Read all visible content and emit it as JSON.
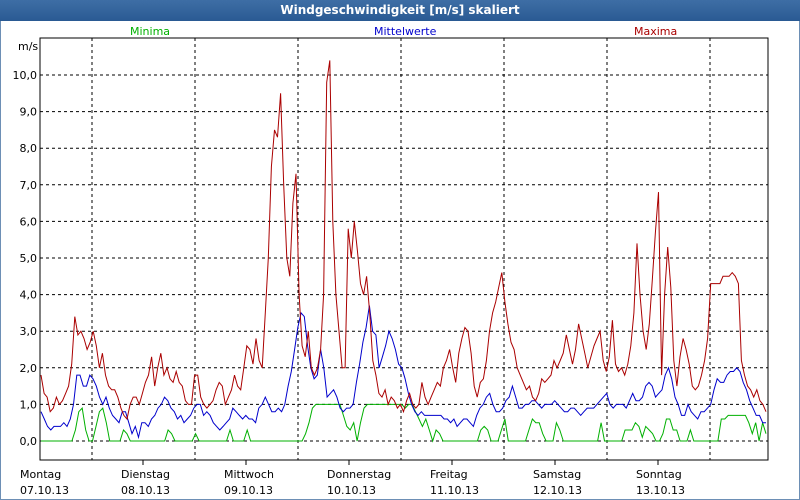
{
  "window": {
    "title": "Windgeschwindigkeit [m/s] skaliert"
  },
  "colors": {
    "minima": "#00b000",
    "mittelwerte": "#0000cc",
    "maxima": "#aa0000",
    "title_bg": "#2f5f98",
    "grid": "#000000"
  },
  "chart_data": {
    "type": "line",
    "title": "Windgeschwindigkeit [m/s] skaliert",
    "ylabel": "m/s",
    "ylim": [
      -0.2,
      10.8
    ],
    "yticks": [
      "0,0",
      "1,0",
      "2,0",
      "3,0",
      "4,0",
      "5,0",
      "6,0",
      "7,0",
      "8,0",
      "9,0",
      "10,0"
    ],
    "days": [
      {
        "name": "Montag",
        "date": "07.10.13"
      },
      {
        "name": "Dienstag",
        "date": "08.10.13"
      },
      {
        "name": "Mittwoch",
        "date": "09.10.13"
      },
      {
        "name": "Donnerstag",
        "date": "10.10.13"
      },
      {
        "name": "Freitag",
        "date": "11.10.13"
      },
      {
        "name": "Samstag",
        "date": "12.10.13"
      },
      {
        "name": "Sonntag",
        "date": "13.10.13"
      }
    ],
    "legend_position": "top",
    "grid": true,
    "series": [
      {
        "name": "Minima",
        "values": [
          0,
          0,
          0,
          0,
          0,
          0,
          0,
          0,
          0,
          0,
          0.3,
          0.8,
          0.9,
          0.3,
          0,
          0,
          0.4,
          0.8,
          0.9,
          0.5,
          0,
          0,
          0,
          0,
          0.3,
          0.2,
          0,
          0,
          0,
          0,
          0,
          0,
          0,
          0,
          0,
          0,
          0,
          0.3,
          0.2,
          0,
          0,
          0,
          0,
          0,
          0,
          0.2,
          0,
          0,
          0,
          0,
          0,
          0,
          0,
          0,
          0,
          0.3,
          0,
          0,
          0,
          0,
          0.3,
          0,
          0,
          0,
          0,
          0,
          0,
          0,
          0,
          0,
          0,
          0,
          0,
          0,
          0,
          0,
          0,
          0.2,
          0.5,
          0.9,
          1.0,
          1.0,
          1.0,
          1.0,
          1.0,
          1.0,
          1.0,
          1.0,
          0.7,
          0.4,
          0.3,
          0.5,
          0,
          0.5,
          0.9,
          1.0,
          1.0,
          1.0,
          1.0,
          1.0,
          1.0,
          1.0,
          1.0,
          1.0,
          1.0,
          1.0,
          0.9,
          1.0,
          1.0,
          0.8,
          0.6,
          0.4,
          0.6,
          0.3,
          0,
          0.3,
          0.2,
          0,
          0,
          0,
          0,
          0,
          0,
          0,
          0,
          0,
          0,
          0,
          0.3,
          0.4,
          0.3,
          0,
          0,
          0,
          0.3,
          0.6,
          0,
          0,
          0,
          0,
          0,
          0,
          0.3,
          0.6,
          0.5,
          0.5,
          0.2,
          0,
          0,
          0,
          0.5,
          0.3,
          0,
          0,
          0,
          0,
          0,
          0,
          0,
          0,
          0,
          0,
          0,
          0.5,
          0,
          0,
          0,
          0,
          0,
          0,
          0.3,
          0.3,
          0.3,
          0.5,
          0.4,
          0.1,
          0.4,
          0.3,
          0.2,
          0,
          0,
          0.2,
          0.6,
          0.6,
          0.3,
          0.3,
          0,
          0,
          0,
          0.3,
          0,
          0,
          0,
          0,
          0,
          0,
          0,
          0,
          0.6,
          0.6,
          0.7,
          0.7,
          0.7,
          0.7,
          0.7,
          0.7,
          0.5,
          0.2,
          0.5,
          0,
          0.5,
          0.2
        ]
      },
      {
        "name": "Mittelwerte",
        "values": [
          0.8,
          0.6,
          0.4,
          0.3,
          0.4,
          0.4,
          0.4,
          0.5,
          0.4,
          0.6,
          1.0,
          1.8,
          1.8,
          1.5,
          1.5,
          1.8,
          1.7,
          1.5,
          1.2,
          1.0,
          1.2,
          0.9,
          0.7,
          0.6,
          0.5,
          0.8,
          0.8,
          0.5,
          0.2,
          0.4,
          0.1,
          0.5,
          0.5,
          0.4,
          0.6,
          0.7,
          0.9,
          1.0,
          1.2,
          1.1,
          0.9,
          0.8,
          0.6,
          0.7,
          0.5,
          0.6,
          0.7,
          0.9,
          1.0,
          1.0,
          0.7,
          0.8,
          0.7,
          0.5,
          0.4,
          0.3,
          0.4,
          0.5,
          0.6,
          0.9,
          0.8,
          0.7,
          0.6,
          0.7,
          0.6,
          0.6,
          0.5,
          0.9,
          1.0,
          1.2,
          1.0,
          0.8,
          0.8,
          0.9,
          0.8,
          1.0,
          1.5,
          1.9,
          2.5,
          3.1,
          3.5,
          3.4,
          2.6,
          2.0,
          1.7,
          1.8,
          2.5,
          2.0,
          1.2,
          1.3,
          1.4,
          1.2,
          0.9,
          0.8,
          0.9,
          0.9,
          1.0,
          1.6,
          2.1,
          2.7,
          3.1,
          3.7,
          3.0,
          2.9,
          2.0,
          2.3,
          2.6,
          3.0,
          2.8,
          2.5,
          2.1,
          2.0,
          1.7,
          1.3,
          1.0,
          0.8,
          0.7,
          0.8,
          0.7,
          0.7,
          0.7,
          0.7,
          0.7,
          0.7,
          0.6,
          0.6,
          0.5,
          0.6,
          0.4,
          0.5,
          0.6,
          0.6,
          0.5,
          0.4,
          0.7,
          0.9,
          1.0,
          1.2,
          1.3,
          1.0,
          0.8,
          0.8,
          0.9,
          1.1,
          1.2,
          1.5,
          1.2,
          0.9,
          0.9,
          1.0,
          1.0,
          1.1,
          1.1,
          1.0,
          0.9,
          1.0,
          1.0,
          1.0,
          1.1,
          1.0,
          0.9,
          0.8,
          0.8,
          0.9,
          0.9,
          0.8,
          0.7,
          0.8,
          0.9,
          0.9,
          0.9,
          1.0,
          1.1,
          1.2,
          1.3,
          1.0,
          0.9,
          1.0,
          1.0,
          1.0,
          0.9,
          1.1,
          1.3,
          1.1,
          1.1,
          1.2,
          1.5,
          1.6,
          1.5,
          1.2,
          1.3,
          1.4,
          1.8,
          2.0,
          1.7,
          1.2,
          1.0,
          0.7,
          0.7,
          1.0,
          0.8,
          0.7,
          0.6,
          0.8,
          0.8,
          0.9,
          1.0,
          1.4,
          1.7,
          1.6,
          1.6,
          1.8,
          1.9,
          1.9,
          2.0,
          1.9,
          1.6,
          1.4,
          1.1,
          0.9,
          0.7,
          0.7,
          0.5,
          0.5
        ]
      },
      {
        "name": "Maxima",
        "values": [
          1.8,
          1.3,
          1.2,
          0.8,
          0.9,
          1.2,
          1.0,
          1.1,
          1.3,
          1.5,
          2.1,
          3.4,
          2.9,
          3.0,
          2.8,
          2.5,
          2.7,
          3.0,
          2.6,
          2.0,
          2.4,
          1.8,
          1.5,
          1.4,
          1.4,
          1.2,
          0.9,
          0.7,
          0.6,
          1.0,
          1.2,
          1.2,
          1.0,
          1.3,
          1.6,
          1.8,
          2.3,
          1.5,
          2.0,
          2.4,
          1.8,
          2.0,
          1.7,
          1.6,
          1.9,
          1.6,
          1.5,
          1.1,
          1.0,
          1.0,
          1.8,
          1.8,
          1.2,
          1.0,
          0.9,
          1.0,
          1.1,
          1.4,
          1.6,
          1.5,
          1.0,
          1.2,
          1.4,
          1.8,
          1.5,
          1.4,
          2.0,
          2.6,
          2.5,
          2.1,
          2.8,
          2.2,
          2.0,
          3.5,
          5.0,
          7.5,
          8.5,
          8.3,
          9.5,
          7.0,
          5.0,
          4.5,
          6.5,
          7.3,
          4.0,
          2.6,
          2.3,
          3.0,
          2.0,
          1.8,
          2.0,
          2.5,
          4.0,
          9.8,
          10.4,
          6.0,
          4.0,
          3.0,
          2.0,
          2.0,
          5.8,
          5.0,
          6.0,
          5.2,
          4.3,
          4.0,
          4.5,
          3.5,
          2.2,
          1.8,
          1.3,
          1.2,
          1.4,
          1.0,
          1.2,
          1.1,
          0.9,
          1.0,
          0.8,
          1.1,
          1.3,
          1.0,
          0.9,
          1.0,
          1.6,
          1.2,
          1.0,
          1.2,
          1.4,
          1.6,
          1.5,
          2.0,
          2.2,
          2.5,
          2.0,
          1.6,
          2.4,
          2.8,
          3.1,
          3.0,
          2.4,
          1.5,
          1.2,
          1.6,
          1.7,
          2.2,
          3.0,
          3.5,
          3.8,
          4.2,
          4.6,
          3.8,
          3.2,
          2.7,
          2.5,
          2.0,
          1.8,
          1.6,
          1.4,
          1.5,
          1.2,
          1.1,
          1.3,
          1.7,
          1.6,
          1.7,
          1.8,
          2.2,
          2.0,
          2.2,
          2.4,
          2.9,
          2.5,
          2.1,
          2.5,
          3.2,
          2.8,
          2.4,
          2.0,
          2.3,
          2.6,
          2.8,
          3.0,
          2.2,
          1.9,
          2.3,
          3.3,
          2.1,
          1.9,
          2.0,
          1.8,
          2.1,
          2.6,
          3.5,
          5.4,
          4.0,
          3.0,
          2.5,
          3.2,
          4.4,
          5.7,
          6.8,
          1.8,
          4.0,
          5.3,
          4.2,
          2.2,
          1.5,
          2.3,
          2.8,
          2.5,
          2.1,
          1.5,
          1.4,
          1.5,
          1.8,
          2.2,
          2.8,
          4.3,
          4.3,
          4.3,
          4.3,
          4.5,
          4.5,
          4.5,
          4.6,
          4.5,
          4.3,
          2.2,
          1.8,
          1.5,
          1.4,
          1.2,
          1.4,
          1.1,
          1.0,
          0.8
        ]
      }
    ]
  }
}
